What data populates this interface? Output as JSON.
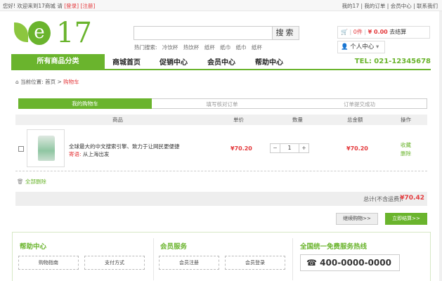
{
  "topbar": {
    "welcome": "您好! 欢迎来到17商城 请",
    "login": "[登录]",
    "register": "[注册]",
    "links": "我的17 | 我的订单 | 会员中心 | 联系我们"
  },
  "logo": {
    "letter": "e",
    "number": "17"
  },
  "search": {
    "button": "搜索",
    "hot_label": "热门搜索:",
    "hot_words": [
      "冷饮杯",
      "热饮杯",
      "纸杯",
      "纸巾",
      "纸巾",
      "纸杯"
    ]
  },
  "cart": {
    "count": "0件",
    "amount": "¥ 0.00",
    "checkout": "去结算"
  },
  "user": {
    "label": "个人中心"
  },
  "nav": {
    "category": "所有商品分类",
    "items": [
      "商城首页",
      "促销中心",
      "会员中心",
      "帮助中心"
    ],
    "phone": "TEL: 021-12345678"
  },
  "breadcrumb": {
    "prefix": "当前位置:",
    "home": "首页",
    "current": "购物车"
  },
  "steps": [
    "我的购物车",
    "填写核对订单",
    "订单提交成功"
  ],
  "table": {
    "headers": [
      "商品",
      "单价",
      "数量",
      "总金额",
      "操作"
    ],
    "row": {
      "name": "全球最大的中文搜索引擎、致力于让网民更便捷",
      "ship_label": "寄语:",
      "ship_value": "从上海出发",
      "price": "¥70.20",
      "qty": "1",
      "subtotal": "¥70.20",
      "fav": "收藏",
      "del": "删除"
    }
  },
  "delete_all": "全部删除",
  "total": {
    "label": "总计(不含运费):",
    "value": "¥70.42"
  },
  "buttons": {
    "continue": "继续购物>>",
    "checkout": "立即结算>>"
  },
  "footer": {
    "help_title": "帮助中心",
    "help_items": [
      "购物指南",
      "支付方式"
    ],
    "member_title": "会员服务",
    "member_items": [
      "会员注册",
      "会员登录"
    ],
    "hotline_title": "全国统一免费服务热线",
    "hotline": "400-0000-0000"
  }
}
